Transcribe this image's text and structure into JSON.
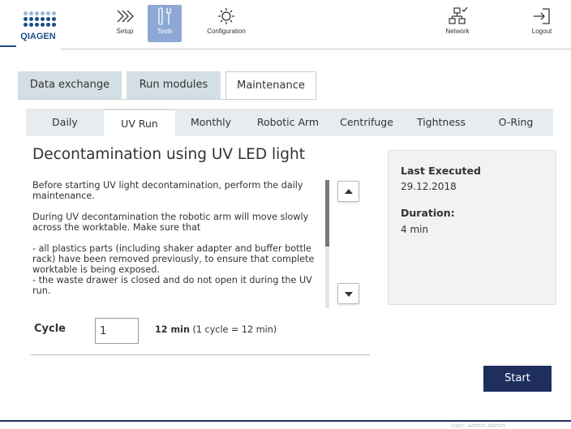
{
  "brand": {
    "logo_text": "QIAGEN",
    "color": "#1a4e8a"
  },
  "header": {
    "nav": [
      {
        "label": "Setup",
        "icon": "setup-icon"
      },
      {
        "label": "Tools",
        "icon": "tools-icon",
        "active": true
      },
      {
        "label": "Configuration",
        "icon": "configuration-icon"
      },
      {
        "label": "Network",
        "icon": "network-icon"
      },
      {
        "label": "Logout",
        "icon": "logout-icon"
      }
    ]
  },
  "section_tabs": [
    {
      "label": "Data exchange"
    },
    {
      "label": "Run modules"
    },
    {
      "label": "Maintenance",
      "active": true
    }
  ],
  "maintenance_tabs": [
    {
      "label": "Daily"
    },
    {
      "label": "UV Run",
      "active": true
    },
    {
      "label": "Monthly"
    },
    {
      "label": "Robotic Arm"
    },
    {
      "label": "Centrifuge"
    },
    {
      "label": "Tightness"
    },
    {
      "label": "O-Ring"
    }
  ],
  "main": {
    "title": "Decontamination using UV LED light",
    "paragraphs": [
      "Before starting UV light decontamination, perform the daily maintenance.",
      "During UV decontamination the robotic arm will move slowly across the worktable. Make sure that",
      "- all plastics parts (including shaker adapter and buffer bottle rack) have been removed previously, to ensure that complete worktable is being exposed.\n- the waste drawer is closed and do not open it during the UV run."
    ],
    "cycle": {
      "label": "Cycle",
      "value": "1",
      "duration": "12 min",
      "note": "(1 cycle = 12 min)"
    },
    "start_label": "Start"
  },
  "info": {
    "last_executed_label": "Last Executed",
    "last_executed_value": "29.12.2018",
    "duration_label": "Duration:",
    "duration_value": "4 min"
  },
  "footer": {
    "user": "User: Admin Admin"
  },
  "colors": {
    "primary": "#1e2f5e",
    "tab": "#d4dee5",
    "active_nav": "#8ea8d6"
  }
}
